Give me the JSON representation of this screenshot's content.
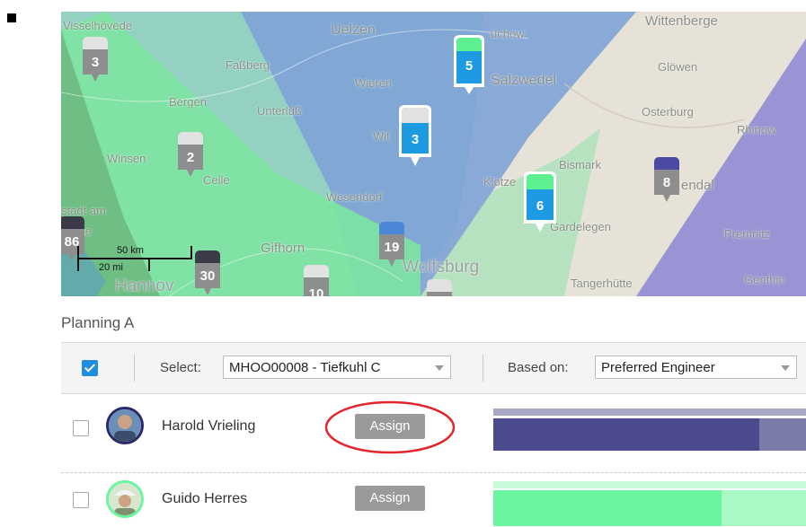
{
  "map": {
    "place_labels": [
      "Visselhövede",
      "Uelzen",
      "üchow",
      "Wittenberge",
      "Faßberg",
      "Wieren",
      "Salzwedel",
      "Glöwen",
      "Bergen",
      "Unterlüß",
      "Osterburg",
      "Rhinow",
      "Winsen",
      "Celle",
      "Wit",
      "Bismark",
      "Klötze",
      "endal",
      "Wesendorf",
      "Gardelegen",
      "stadt am",
      "erge",
      "Premnitz",
      "Gifhorn",
      "Wolfsburg",
      "Tangerhütte",
      "Genthin",
      "Hannov"
    ],
    "markers": [
      {
        "count": "3",
        "color": "#e2e2e2"
      },
      {
        "count": "2",
        "color": "#e2e2e2"
      },
      {
        "count": "5",
        "color": "#5df08f"
      },
      {
        "count": "3",
        "color": "#e2e2e2"
      },
      {
        "count": "6",
        "color": "#5df08f"
      },
      {
        "count": "8",
        "color": "#4a4aa3"
      },
      {
        "count": "19",
        "color": "#4a87d6"
      },
      {
        "count": "86",
        "color": "#3a3a48"
      },
      {
        "count": "30",
        "color": "#3a3a48"
      },
      {
        "count": "10",
        "color": "#e2e2e2"
      }
    ],
    "scale": {
      "km": "50 km",
      "mi": "20 mi"
    }
  },
  "panel_title": "Planning A",
  "toolbar": {
    "select_label": "Select:",
    "select_value": "MHOO00008 - Tiefkuhl C",
    "based_on_label": "Based on:",
    "based_on_value": "Preferred Engineer"
  },
  "engineers": [
    {
      "name": "Harold Vrieling",
      "assign_label": "Assign",
      "bar_color": "#4a4a8c",
      "bar_light": "#7a7aab"
    },
    {
      "name": "Guido Herres",
      "assign_label": "Assign",
      "bar_color": "#6cf5a0",
      "bar_light": "#a8f9c6"
    }
  ]
}
